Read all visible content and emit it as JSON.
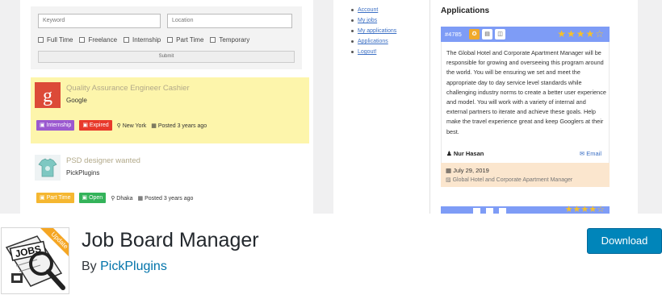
{
  "search": {
    "keyword_placeholder": "Keyword",
    "location_placeholder": "Location",
    "job_types": [
      "Full Time",
      "Freelance",
      "Internship",
      "Part Time",
      "Temporary"
    ],
    "submit_label": "Submit"
  },
  "jobs": [
    {
      "title": "Quality Assurance Engineer Cashier",
      "company": "Google",
      "logo_letter": "g",
      "tags": [
        {
          "label": "Internship",
          "color": "#9b59d0"
        },
        {
          "label": "Expired",
          "color": "#e8392b"
        }
      ],
      "location": "New York",
      "posted": "Posted 3 years ago"
    },
    {
      "title": "PSD designer wanted",
      "company": "PickPlugins",
      "tags": [
        {
          "label": "Part Time",
          "color": "#f5b731"
        },
        {
          "label": "Open",
          "color": "#34b35a"
        }
      ],
      "location": "Dhaka",
      "posted": "Posted 3 years ago"
    }
  ],
  "account_menu": [
    "Account",
    "My jobs",
    "My applications",
    "Applications",
    "Logout!"
  ],
  "applications": {
    "title": "Applications",
    "item": {
      "id": "#4785",
      "rating_stars": "★★★★☆",
      "text": "The Global Hotel and Corporate Apartment Manager will be responsible for growing and overseeing this program around the world. You will be ensuring we set and meet the appropriate day to day service level standards while challenging industry norms to create a better user experience and model. You will work with a variety of internal and external partners to iterate and achieve these goals. Help make the travel experience great and keep Googlers at their best.",
      "applicant": "Nur Hasan",
      "email_label": "Email",
      "date": "July 29, 2019",
      "job_ref": "Global Hotel and Corporate Apartment Manager"
    }
  },
  "plugin": {
    "name": "Job Board Manager",
    "by_prefix": "By ",
    "author": "PickPlugins",
    "download_label": "Download",
    "icon_ribbon": "Update",
    "icon_word": "JOBS"
  },
  "colors": {
    "accent_blue": "#0085ba",
    "app_header": "#7e9cf6",
    "featured_bg": "#fdf5ab"
  }
}
